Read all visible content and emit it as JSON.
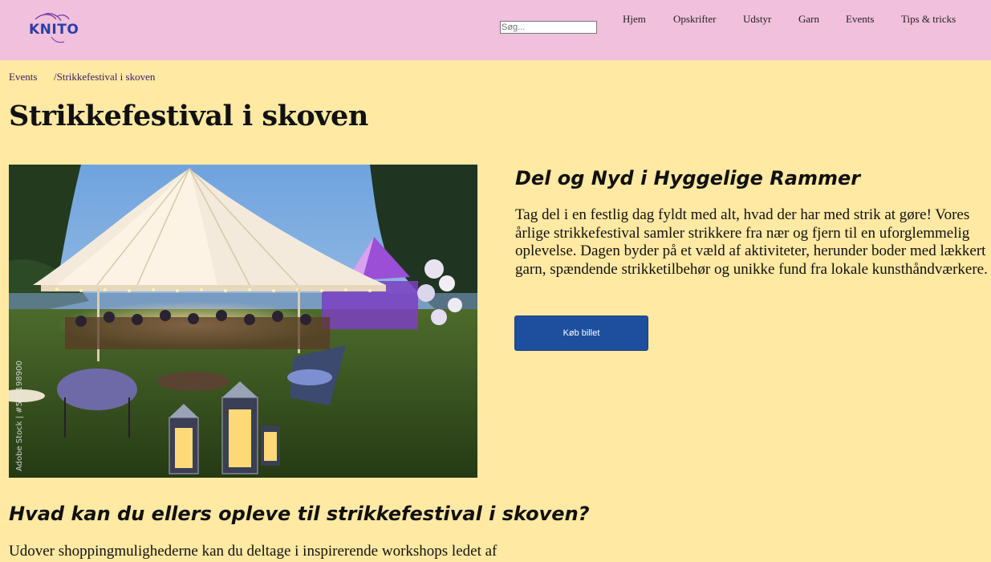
{
  "header": {
    "logo_text": "KNITO",
    "search_placeholder": "Søg...",
    "nav": [
      "Hjem",
      "Opskrifter",
      "Udstyr",
      "Garn",
      "Events",
      "Tips & tricks"
    ]
  },
  "breadcrumb": {
    "parent": "Events",
    "current": "/Strikkefestival i skoven"
  },
  "page_title": "Strikkefestival i skoven",
  "photo": {
    "credit": "Adobe Stock | #502198900"
  },
  "intro": {
    "heading": "Del og Nyd i Hyggelige Rammer",
    "paragraph": "Tag del i en festlig dag fyldt med alt, hvad der har med strik at gøre! Vores årlige strikkefestival samler strikkere fra nær og fjern til en uforglemmelig oplevelse. Dagen byder på et væld af aktiviteter, herunder boder med lækkert garn, spændende strikketilbehør og unikke fund fra lokale kunsthåndværkere.",
    "button": "Køb billet"
  },
  "more": {
    "heading": "Hvad kan du ellers opleve til strikkefestival i skoven?",
    "text": "Udover shoppingmulighederne kan du deltage i inspirerende workshops ledet af"
  },
  "colors": {
    "header_bg": "#f0c0dc",
    "page_bg": "#ffe9a3",
    "button_bg": "#1d4f9e",
    "logo": "#2a3fa8"
  }
}
